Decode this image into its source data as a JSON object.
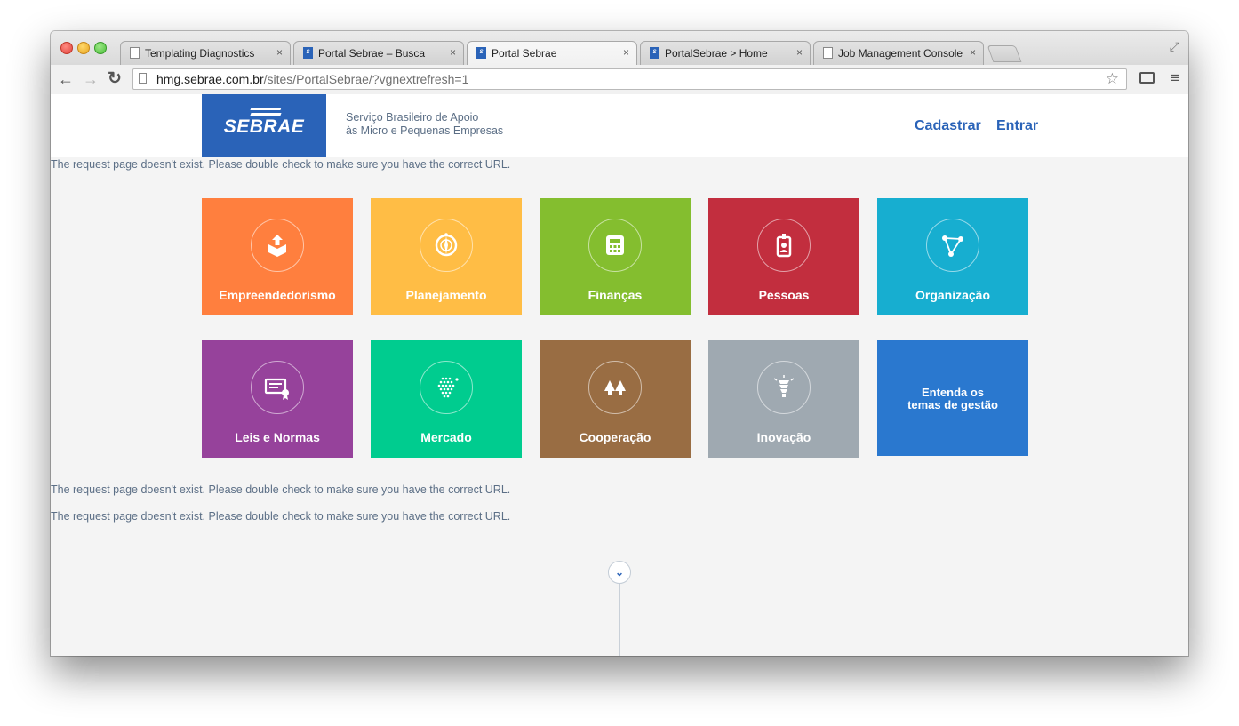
{
  "browser": {
    "tabs": [
      {
        "title": "Templating Diagnostics",
        "favicon": "document-icon"
      },
      {
        "title": "Portal Sebrae – Busca",
        "favicon": "sebrae-icon"
      },
      {
        "title": "Portal Sebrae",
        "favicon": "sebrae-icon",
        "active": true
      },
      {
        "title": "PortalSebrae > Home",
        "favicon": "sebrae-icon"
      },
      {
        "title": "Job Management Console",
        "favicon": "document-icon"
      }
    ],
    "close_glyph": "×",
    "url_host": "hmg.sebrae.com.br",
    "url_path": "/sites/PortalSebrae/?vgnextrefresh=1"
  },
  "header": {
    "logo_text": "SEBRAE",
    "tagline_line1": "Serviço Brasileiro de Apoio",
    "tagline_line2": "às Micro e Pequenas Empresas",
    "cadastrar": "Cadastrar",
    "entrar": "Entrar"
  },
  "messages": {
    "error": "The request page doesn't exist. Please double check to make sure you have the correct URL."
  },
  "tiles": [
    {
      "label": "Empreendedorismo",
      "color": "#ff7f3e",
      "icon": "box-upload-icon"
    },
    {
      "label": "Planejamento",
      "color": "#ffbd45",
      "icon": "compass-icon"
    },
    {
      "label": "Finanças",
      "color": "#84be2f",
      "icon": "calculator-icon"
    },
    {
      "label": "Pessoas",
      "color": "#c22e3e",
      "icon": "id-badge-icon"
    },
    {
      "label": "Organização",
      "color": "#17aed0",
      "icon": "network-icon"
    },
    {
      "label": "Leis e Normas",
      "color": "#96429b",
      "icon": "certificate-icon"
    },
    {
      "label": "Mercado",
      "color": "#00cc8f",
      "icon": "dots-cluster-icon"
    },
    {
      "label": "Cooperação",
      "color": "#996d43",
      "icon": "trees-icon"
    },
    {
      "label": "Inovação",
      "color": "#9fa9b1",
      "icon": "lightbulb-icon"
    }
  ],
  "cta": {
    "line1": "Entenda os",
    "line2": "temas de gestão",
    "color": "#2a78cf"
  },
  "colors": {
    "brand_blue": "#2a63b8",
    "text_muted": "#5c6f86"
  }
}
